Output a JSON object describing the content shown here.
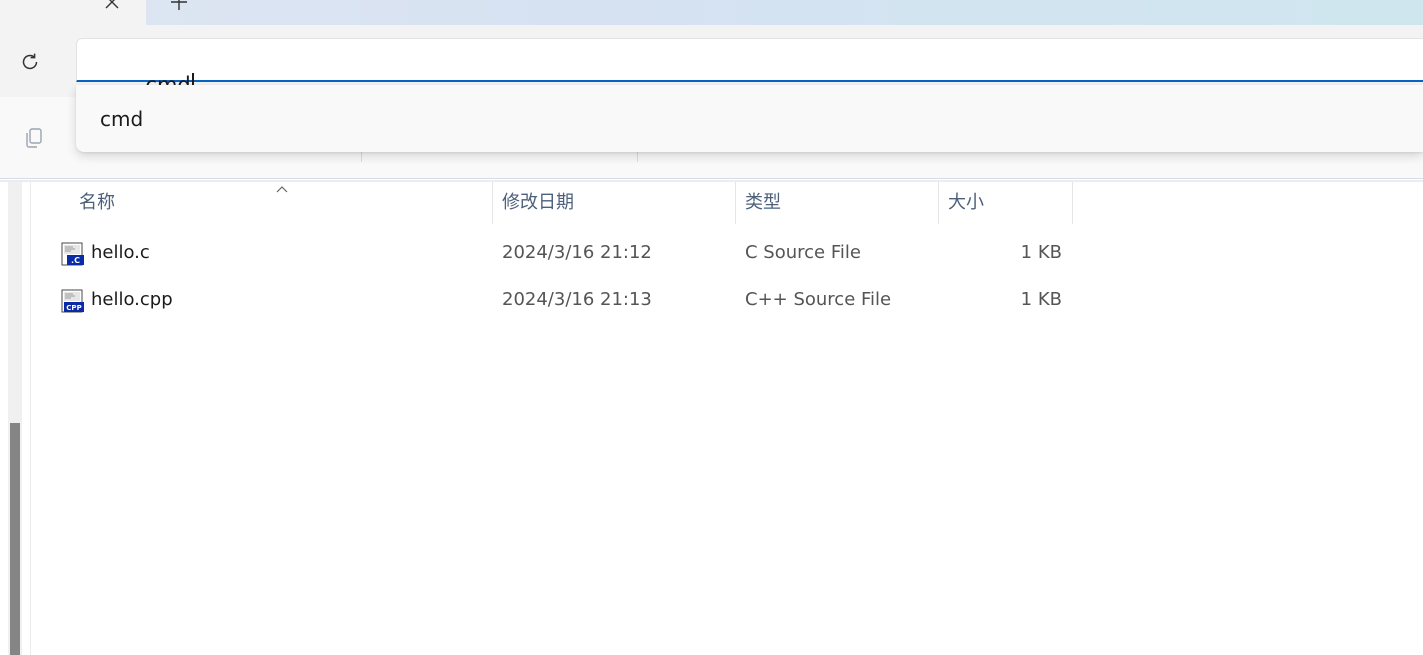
{
  "address_bar": {
    "value": "cmd",
    "focused": true,
    "accent_color": "#0863c4"
  },
  "suggestions": {
    "items": [
      {
        "label": "cmd"
      }
    ]
  },
  "file_list": {
    "columns": {
      "name": "名称",
      "date_modified": "修改日期",
      "type": "类型",
      "size": "大小"
    },
    "sorted_by": "name",
    "sort_direction": "ascending",
    "files": [
      {
        "name": "hello.c",
        "date_modified": "2024/3/16 21:12",
        "type": "C Source File",
        "size": "1 KB",
        "icon": "c-source-file-icon",
        "badge": ".C"
      },
      {
        "name": "hello.cpp",
        "date_modified": "2024/3/16 21:13",
        "type": "C++ Source File",
        "size": "1 KB",
        "icon": "cpp-source-file-icon",
        "badge": "CPP"
      }
    ]
  },
  "icons": {
    "tab_close": "close-icon",
    "new_tab": "plus-icon",
    "refresh": "refresh-icon",
    "copy": "copy-icon",
    "sort": "sort-ascending-icon"
  }
}
